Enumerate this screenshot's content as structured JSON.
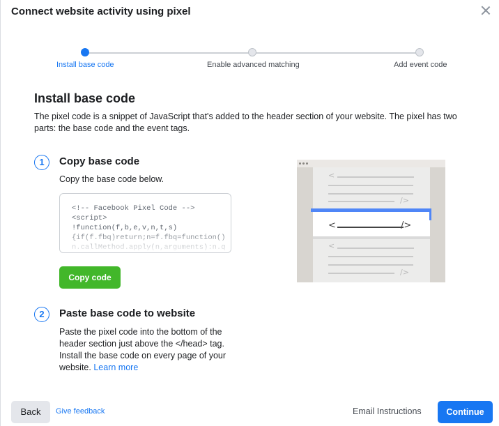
{
  "dialog": {
    "title": "Connect website activity using pixel",
    "close_icon": "close-icon"
  },
  "stepper": {
    "steps": [
      {
        "label": "Install base code",
        "state": "active"
      },
      {
        "label": "Enable advanced matching",
        "state": "inactive"
      },
      {
        "label": "Add event code",
        "state": "inactive"
      }
    ]
  },
  "main": {
    "heading": "Install base code",
    "intro": "The pixel code is a snippet of JavaScript that's added to the header section of your website. The pixel has two parts: the base code and the event tags."
  },
  "step1": {
    "number": "1",
    "title": "Copy base code",
    "description": "Copy the base code below.",
    "code": "<!-- Facebook Pixel Code -->\n<script>\n!function(f,b,e,v,n,t,s)\n{if(f.fbq)return;n=f.fbq=function()\nn.callMethod.apply(n,arguments):n.q",
    "copy_button": "Copy code"
  },
  "step2": {
    "number": "2",
    "title": "Paste base code to website",
    "description": "Paste the pixel code into the bottom of the header section just above the </head> tag. Install the base code on every page of your website.",
    "learn_more": "Learn more"
  },
  "footer": {
    "back_button": "Back",
    "feedback_link": "Give feedback",
    "email_instructions": "Email Instructions",
    "continue_button": "Continue"
  },
  "colors": {
    "accent": "#1877f2",
    "copy_button": "#42b72a",
    "highlight": "#4f86f7"
  }
}
